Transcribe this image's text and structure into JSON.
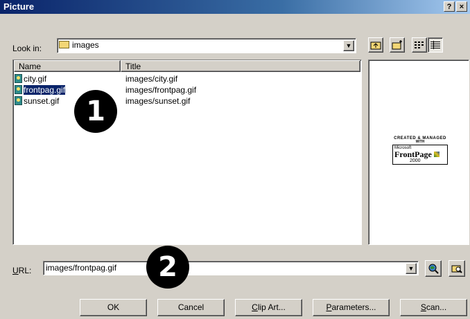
{
  "dialog": {
    "title": "Picture",
    "help_label": "?",
    "close_label": "×"
  },
  "lookin": {
    "label": "Look in:",
    "value": "images"
  },
  "file_list": {
    "columns": [
      "Name",
      "Title"
    ],
    "rows": [
      {
        "name": "city.gif",
        "title": "images/city.gif",
        "selected": false
      },
      {
        "name": "frontpag.gif",
        "title": "images/frontpag.gif",
        "selected": true
      },
      {
        "name": "sunset.gif",
        "title": "images/sunset.gif",
        "selected": false
      }
    ]
  },
  "preview": {
    "logo_line1": "CREATED & MANAGED",
    "logo_line2": "WITH",
    "logo_brand_small": "Microsoft",
    "logo_brand": "FrontPage",
    "logo_year": "2000"
  },
  "markers": {
    "one": "1",
    "two": "2"
  },
  "url": {
    "label": "URL:",
    "value": "images/frontpag.gif"
  },
  "buttons": {
    "ok": "OK",
    "cancel": "Cancel",
    "clipart": "Clip Art...",
    "parameters": "Parameters...",
    "scan": "Scan..."
  },
  "colors": {
    "titlebar": "#0a246a",
    "face": "#d4d0c8",
    "selection": "#0a246a"
  }
}
